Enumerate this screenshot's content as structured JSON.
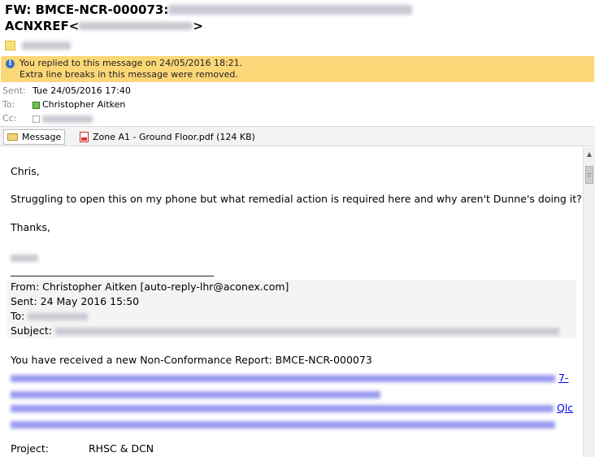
{
  "message": {
    "subject_prefix": "FW: BMCE-NCR-000073: ",
    "subject_line2": "ACNXREF<",
    "subject_line2_end": ">"
  },
  "info_bar": {
    "line1": "You replied to this message on 24/05/2016 18:21.",
    "line2": "Extra line breaks in this message were removed."
  },
  "headers": {
    "sent_label": "Sent:",
    "sent_value": "Tue 24/05/2016 17:40",
    "to_label": "To:",
    "to_value": "Christopher Aitken",
    "cc_label": "Cc:"
  },
  "attachments": {
    "message_tab": "Message",
    "file_name": "Zone A1 - Ground  Floor.pdf (124 KB)"
  },
  "body": {
    "greeting": "Chris,",
    "text": "Struggling to open this on my phone but what remedial action is required here and why aren't Dunne's doing it?",
    "thanks": "Thanks,",
    "separator": "________________________________________",
    "from_line": "From: Christopher Aitken [auto-reply-lhr@aconex.com]",
    "sent_line": "Sent: 24 May 2016 15:50",
    "to_label": "To: ",
    "subject_label": "Subject: ",
    "ncr_line": "You have received a new Non-Conformance Report: BMCE-NCR-000073",
    "link_fragment_1": "7-",
    "link_fragment_2": "Qlc",
    "project_label": "Project:",
    "project_value": "RHSC & DCN"
  },
  "colors": {
    "info_bar": "#fcd777",
    "link": "#0000ee",
    "presence_online": "#6fc24b"
  }
}
